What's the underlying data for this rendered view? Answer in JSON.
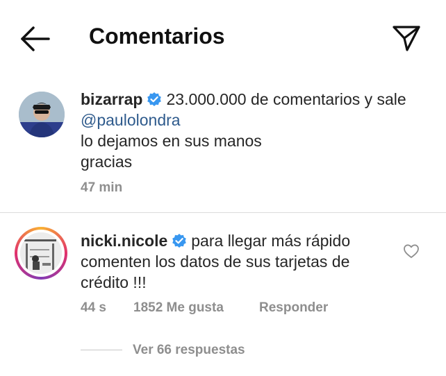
{
  "header": {
    "title": "Comentarios",
    "back_icon": "arrow-left-icon",
    "share_icon": "paper-plane-icon"
  },
  "caption": {
    "username": "bizarrap",
    "verified": true,
    "text_before_mention": "23.000.000 de comentarios y sale ",
    "mention": "@paulolondra",
    "text_lines": [
      "lo dejamos en sus manos",
      "gracias"
    ],
    "time": "47 min"
  },
  "comment": {
    "username": "nicki.nicole",
    "verified": true,
    "text": "para llegar más rápido comenten los datos de sus tarjetas de crédito !!!",
    "time": "44 s",
    "likes": "1852 Me gusta",
    "reply_label": "Responder",
    "view_replies": "Ver 66 respuestas",
    "like_icon": "heart-outline-icon"
  },
  "colors": {
    "verified_blue": "#3897f0",
    "mention": "#2e5a8c",
    "meta_gray": "#8e8e8e"
  }
}
